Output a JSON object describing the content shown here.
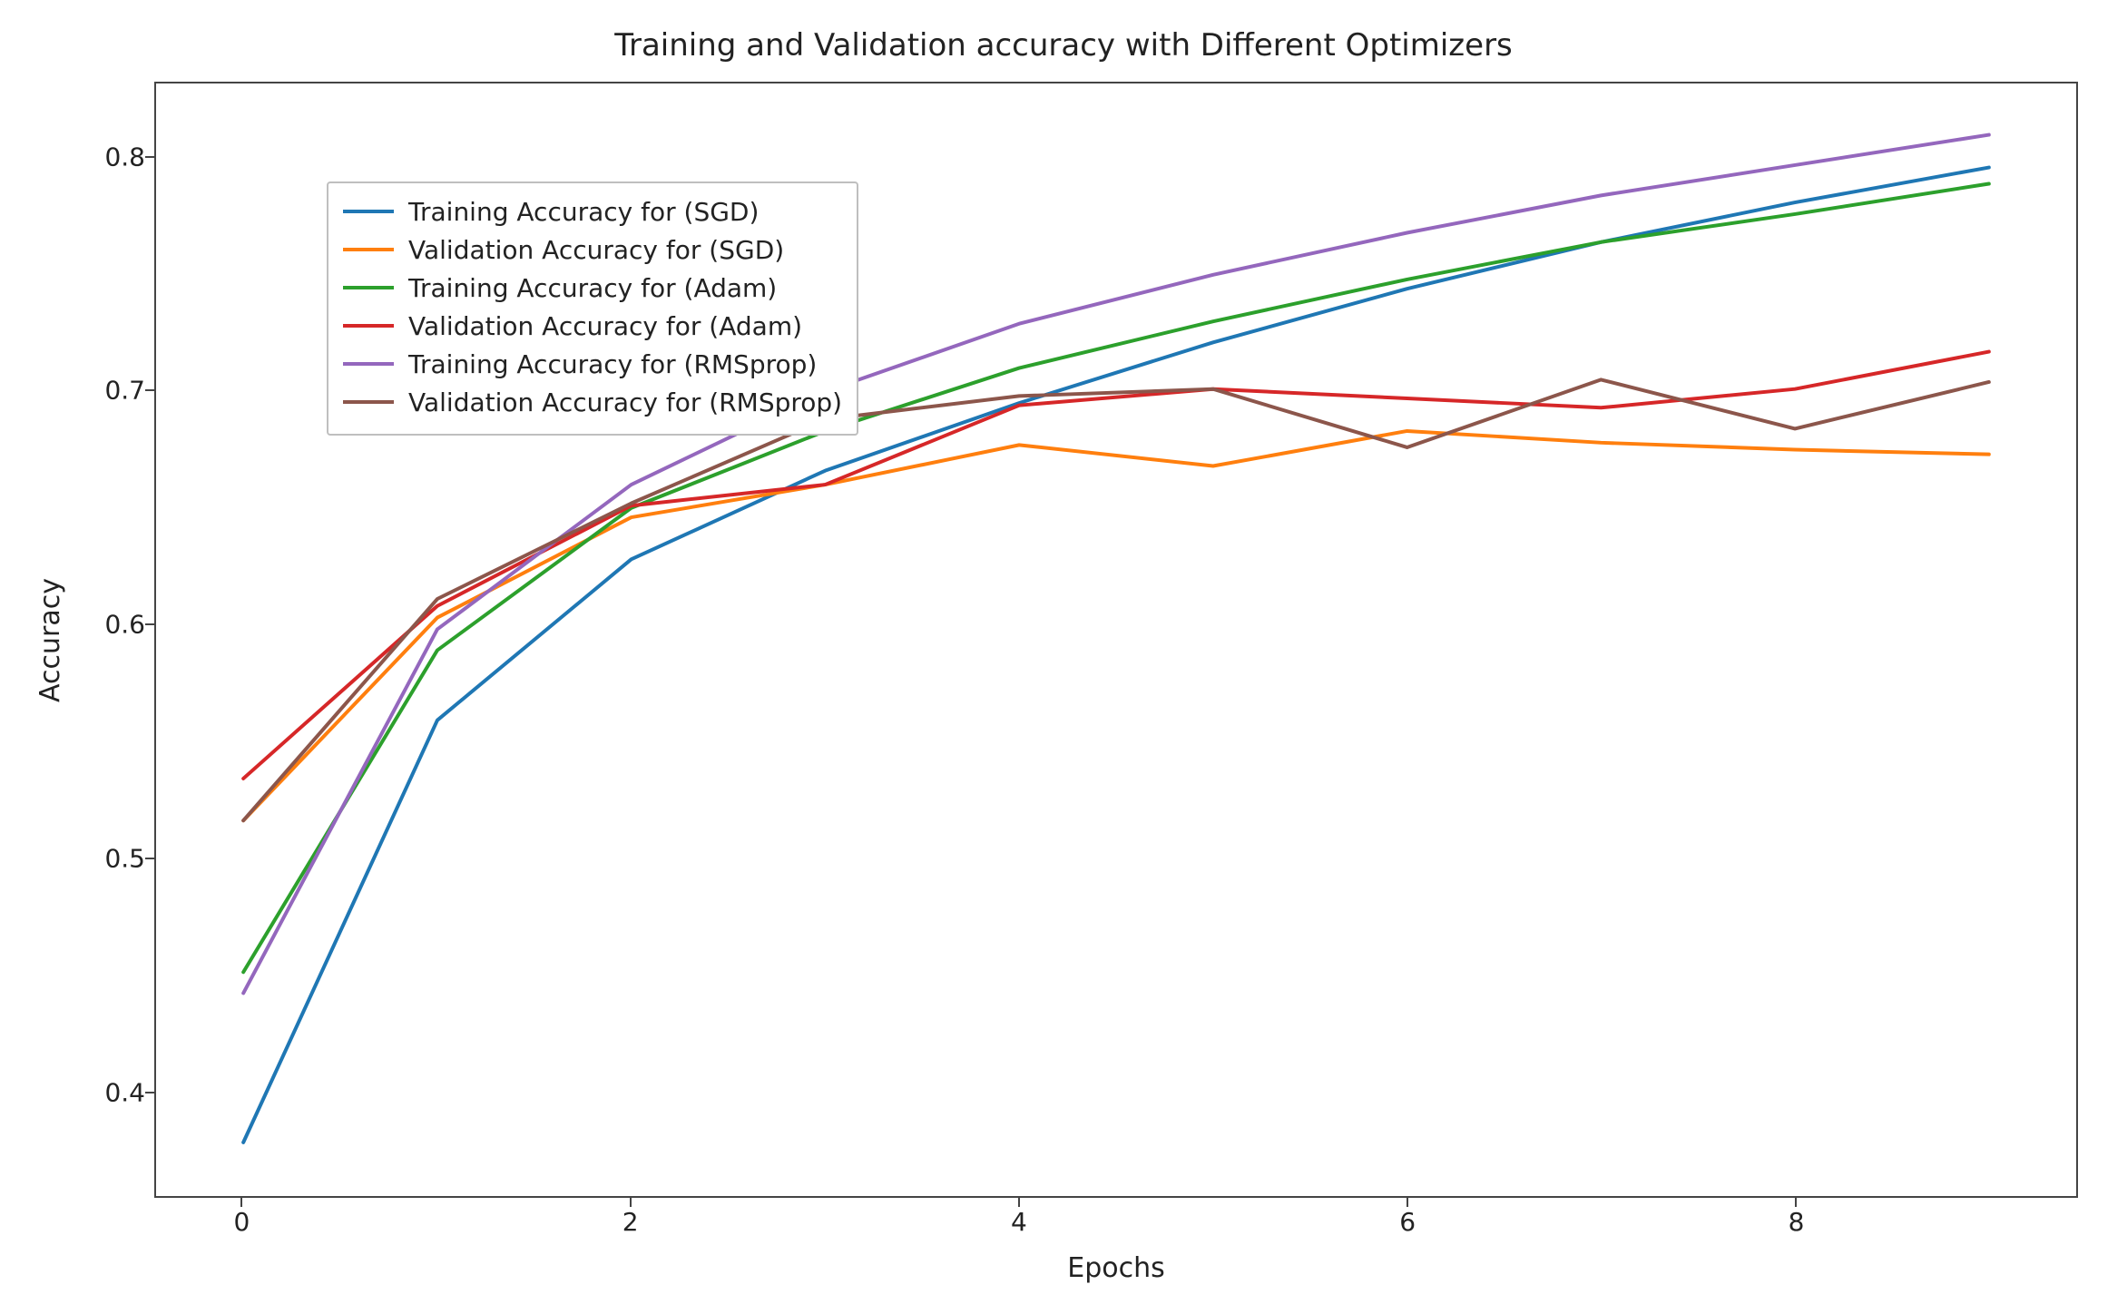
{
  "chart_data": {
    "type": "line",
    "title": "Training and Validation accuracy with Different Optimizers",
    "xlabel": "Epochs",
    "ylabel": "Accuracy",
    "x": [
      0,
      1,
      2,
      3,
      4,
      5,
      6,
      7,
      8,
      9
    ],
    "xticks": [
      0,
      2,
      4,
      6,
      8
    ],
    "yticks": [
      0.4,
      0.5,
      0.6,
      0.7,
      0.8
    ],
    "xlim": [
      -0.45,
      9.45
    ],
    "ylim": [
      0.355,
      0.832
    ],
    "legend_position": "upper left",
    "series": [
      {
        "name": "Training Accuracy for (SGD)",
        "color": "#1f77b4",
        "values": [
          0.378,
          0.559,
          0.628,
          0.666,
          0.695,
          0.721,
          0.744,
          0.764,
          0.781,
          0.796
        ]
      },
      {
        "name": "Validation Accuracy for (SGD)",
        "color": "#ff7f0e",
        "values": [
          0.516,
          0.603,
          0.646,
          0.66,
          0.677,
          0.668,
          0.683,
          0.678,
          0.675,
          0.673
        ]
      },
      {
        "name": "Training Accuracy for (Adam)",
        "color": "#2ca02c",
        "values": [
          0.451,
          0.589,
          0.65,
          0.683,
          0.71,
          0.73,
          0.748,
          0.764,
          0.776,
          0.789
        ]
      },
      {
        "name": "Validation Accuracy for (Adam)",
        "color": "#d62728",
        "values": [
          0.534,
          0.608,
          0.651,
          0.66,
          0.694,
          0.701,
          0.697,
          0.693,
          0.701,
          0.717
        ]
      },
      {
        "name": "Training Accuracy for (RMSprop)",
        "color": "#9467bd",
        "values": [
          0.442,
          0.598,
          0.66,
          0.7,
          0.729,
          0.75,
          0.768,
          0.784,
          0.797,
          0.81
        ]
      },
      {
        "name": "Validation Accuracy for (RMSprop)",
        "color": "#8c564b",
        "values": [
          0.516,
          0.611,
          0.652,
          0.688,
          0.698,
          0.701,
          0.676,
          0.705,
          0.684,
          0.704
        ]
      }
    ]
  }
}
